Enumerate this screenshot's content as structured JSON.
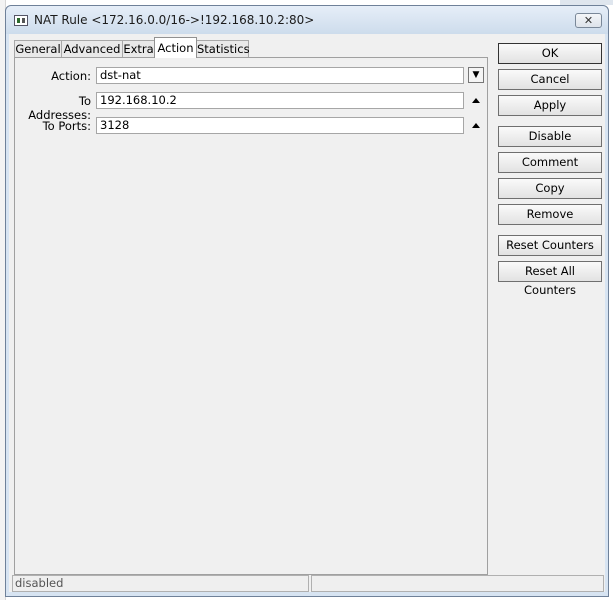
{
  "window": {
    "title": "NAT Rule <172.16.0.0/16->!192.168.10.2:80>",
    "close_glyph": "☒",
    "icon": "nat-rule-window-icon"
  },
  "tabs": [
    {
      "label": "General"
    },
    {
      "label": "Advanced"
    },
    {
      "label": "Extra"
    },
    {
      "label": "Action"
    },
    {
      "label": "Statistics"
    }
  ],
  "active_tab": "Action",
  "form": {
    "action": {
      "label": "Action:",
      "value": "dst-nat"
    },
    "to_addresses": {
      "label": "To Addresses:",
      "value": "192.168.10.2"
    },
    "to_ports": {
      "label": "To Ports:",
      "value": "3128"
    }
  },
  "buttons": {
    "ok": "OK",
    "cancel": "Cancel",
    "apply": "Apply",
    "disable": "Disable",
    "comment": "Comment",
    "copy": "Copy",
    "remove": "Remove",
    "reset_counters": "Reset Counters",
    "reset_all_counters": "Reset All Counters"
  },
  "status": {
    "left": "disabled",
    "right": ""
  },
  "colors": {
    "titlebar": "#cddcec",
    "client_bg": "#f0f0f0",
    "field_bg": "#ffffff"
  }
}
